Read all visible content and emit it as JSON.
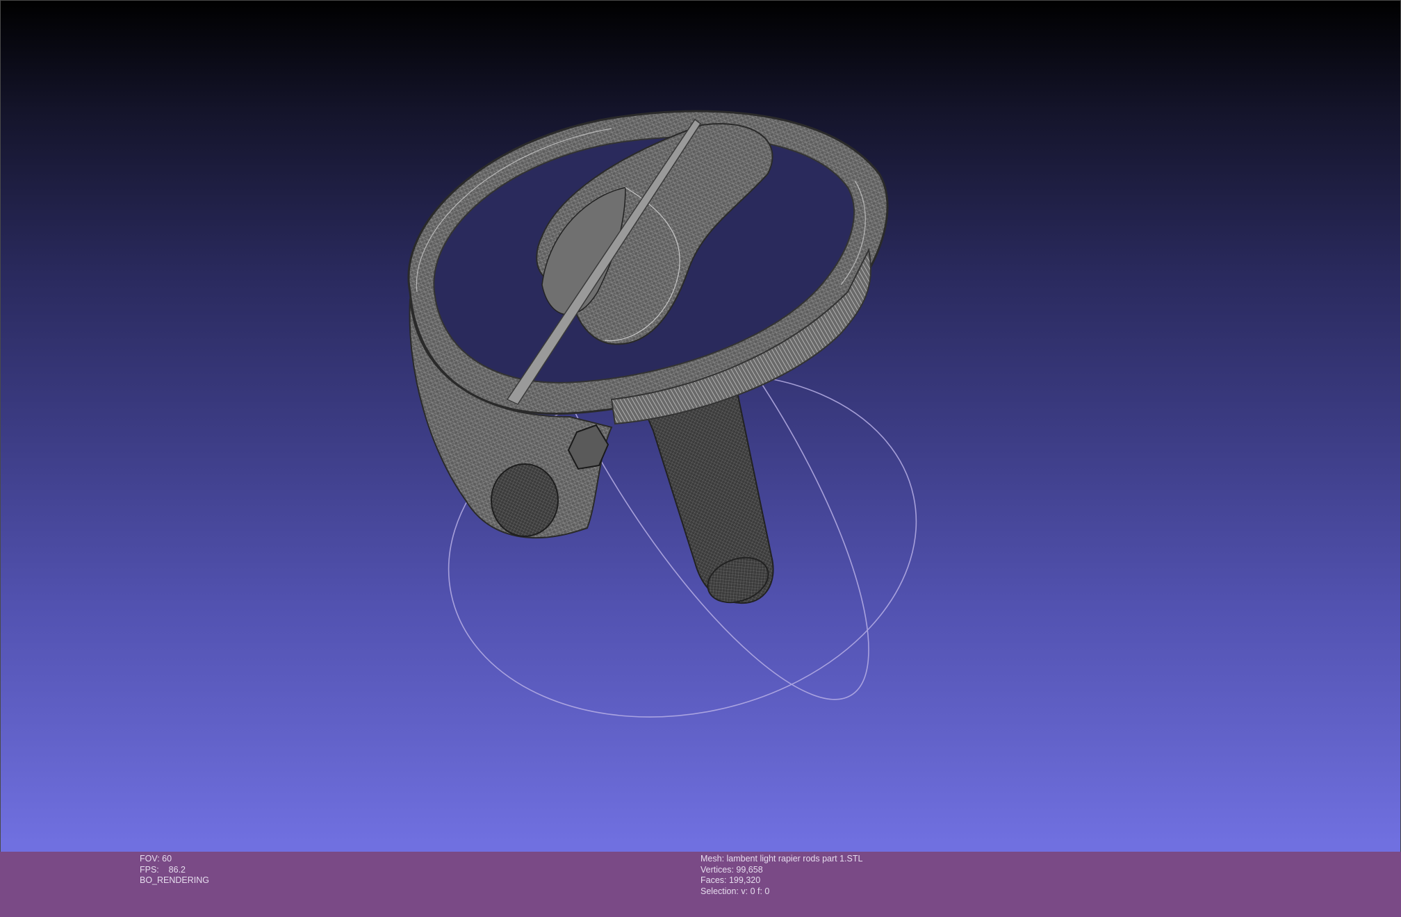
{
  "viewer": {
    "background_top": "#000000",
    "background_bottom": "#7373e6",
    "info_bar_color": "#7a4a86"
  },
  "status_left": {
    "fov": "FOV: 60",
    "fps": "FPS:    86.2",
    "render_mode": "BO_RENDERING"
  },
  "status_right": {
    "mesh": "Mesh: lambent light rapier rods part 1.STL",
    "vertices": "Vertices: 99,658",
    "faces": "Faces: 199,320",
    "selection": "Selection: v: 0 f: 0"
  }
}
